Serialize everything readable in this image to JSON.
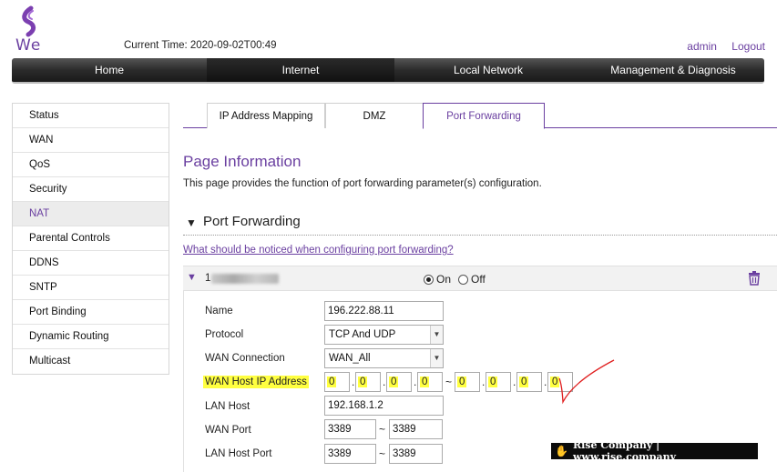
{
  "header": {
    "logo_text": "We",
    "current_time": "Current Time: 2020-09-02T00:49",
    "user": "admin",
    "logout": "Logout"
  },
  "topnav": [
    {
      "label": "Home",
      "active": false
    },
    {
      "label": "Internet",
      "active": true
    },
    {
      "label": "Local Network",
      "active": false
    },
    {
      "label": "Management & Diagnosis",
      "active": false
    }
  ],
  "sidebar": {
    "items": [
      {
        "label": "Status"
      },
      {
        "label": "WAN"
      },
      {
        "label": "QoS"
      },
      {
        "label": "Security"
      },
      {
        "label": "NAT",
        "active": true
      },
      {
        "label": "Parental Controls"
      },
      {
        "label": "DDNS"
      },
      {
        "label": "SNTP"
      },
      {
        "label": "Port Binding"
      },
      {
        "label": "Dynamic Routing"
      },
      {
        "label": "Multicast"
      }
    ]
  },
  "tabs": [
    {
      "label": "IP Address Mapping"
    },
    {
      "label": "DMZ"
    },
    {
      "label": "Port Forwarding",
      "active": true
    }
  ],
  "page": {
    "title": "Page Information",
    "description": "This page provides the function of port forwarding parameter(s) configuration.",
    "section_title": "Port Forwarding",
    "help_link": "What should be noticed when configuring port forwarding?"
  },
  "rule": {
    "index": "1",
    "on_label": "On",
    "off_label": "Off",
    "enabled": true,
    "labels": {
      "name": "Name",
      "protocol": "Protocol",
      "wan_connection": "WAN Connection",
      "wan_host_ip": "WAN Host IP Address",
      "lan_host": "LAN Host",
      "wan_port": "WAN Port",
      "lan_host_port": "LAN Host Port"
    },
    "name": "196.222.88.11",
    "protocol": "TCP And UDP",
    "wan_connection": "WAN_All",
    "wan_ip_start": [
      "0",
      "0",
      "0",
      "0"
    ],
    "wan_ip_end": [
      "0",
      "0",
      "0",
      "0"
    ],
    "lan_host": "192.168.1.2",
    "wan_port_start": "3389",
    "wan_port_end": "3389",
    "lan_port_start": "3389",
    "lan_port_end": "3389",
    "ip_sep": ".",
    "range_sep": "~"
  },
  "watermark": "Rise Company | www.rise.company",
  "colors": {
    "accent": "#6a3fa0",
    "highlight": "#ffff40",
    "annotation": "#e02020"
  }
}
